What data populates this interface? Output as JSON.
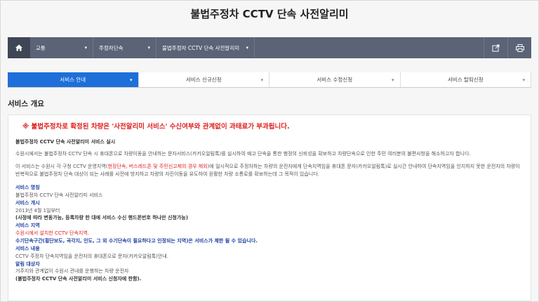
{
  "title": "불법주정차 CCTV 단속 사전알리미",
  "breadcrumb": {
    "items": [
      "교통",
      "주정차단속",
      "불법주정차 CCTV 단속 사전알리미"
    ]
  },
  "tabs": [
    "서비스 안내",
    "서비스 신규신청",
    "서비스 수정신청",
    "서비스 탈퇴신청"
  ],
  "section_title": "서비스 개요",
  "content": {
    "warning": "※ 불법주정차로 확정된 차량은 '사전알리미 서비스' 수신여부와 관계없이 과태료가 부과됩니다.",
    "subtitle": "불법주정차 CCTV 단속 사전알리미 서비스 실시",
    "para1": "수원시에서는 불법주정차 CCTV 단속 시 휴대폰으로 차량이동을 안내하는 문자서비스(카카오알림톡)를 실시하여 예고 단속을 통한 행정의 신뢰성을 확보하고 차량단속으로 인한 주민 여러분의 불편사항을 해소하고자 합니다.",
    "para2_a": "이 서비스는 수원시 각 구청 CCTV 운영지역(",
    "para2_red": "현장단속, 버스레드존 및 주민신고제의 경우 제외",
    "para2_b": ")에 일시적으로 주정차하는 차량의 운전자에게 단속지역임을 휴대폰 문자(카카오알림톡)로 실시간 안내하여 단속지역임을 인지하지 못한 운전자의 차량이 반복적으로 불법주정차 단속 대상이 되는 사례를 사전에 방지하고 차량의 자진이동을 유도하여 원활한 차량 소통로를 확보하는데 그 목적이 있습니다.",
    "h_name": "서비스 명칭",
    "v_name": "불법주정차 CCTV 단속 사전알리미 서비스",
    "h_start": "서비스 개시",
    "v_start": "2013년 4월 1일부터",
    "v_start_note": "(사정에 따라 변동가능, 등록차량 한 대에 서비스 수신 핸드폰번호 하나만 신청가능)",
    "h_area": "서비스 지역",
    "v_area_red": "수원시에서 설치한 CCTV 단속지역.",
    "v_area_blue": "수기단속구간(횡단보도, 곡각지, 인도, 그 외 수기단속이 필요하다고 인정되는 지역)은 서비스가 제한 될 수 있습니다.",
    "h_content": "서비스 내용",
    "v_content": "CCTV 주정차 단속지역임을 운전자의 휴대폰으로 문자(카카오알림톡)안내.",
    "h_target": "알림 대상자",
    "v_target": "거주지와 관계없이 수원시 관내를 운행하는 차량 운전자",
    "v_target_note": "(불법주정차 CCTV 단속 사전알리미 서비스 신청자에 한함)."
  }
}
